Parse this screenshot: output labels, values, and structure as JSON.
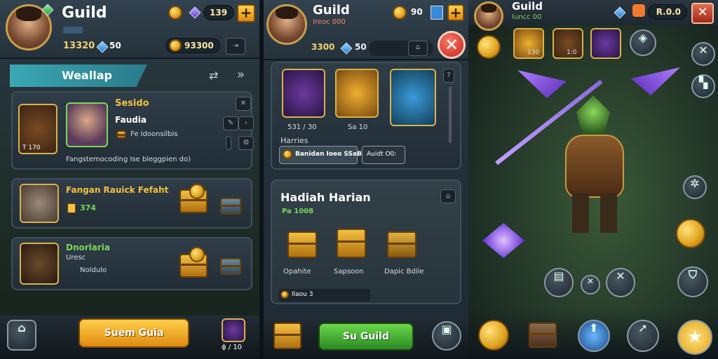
{
  "panel1": {
    "header": {
      "title": "Guild",
      "stat_left": "13320",
      "stat_gems": "50",
      "stat_coins": "93300",
      "gems_top": "139"
    },
    "banner": {
      "label": "Weallap"
    },
    "card1": {
      "title": "Sesido",
      "name": "Faudia",
      "info": "Fe Idoonsilbis",
      "desc": "Fangstemocoding Ise bleggpien do)",
      "levels": "T 170"
    },
    "row1": {
      "title": "Fangan Rauick Fefaht",
      "value": "374"
    },
    "row2": {
      "title": "Dnorlaria",
      "sub": "Uresc",
      "value": "Noldulo"
    },
    "main_button": "Suem Guia",
    "bottom_left": "",
    "bottom_right": "ϕ / 10"
  },
  "panel2": {
    "header": {
      "title": "Guild",
      "subtitle": "Ireoc 000",
      "value_top": "90",
      "stat_left": "3300",
      "stat_gems": "50"
    },
    "items": [
      {
        "label": "531 / 30"
      },
      {
        "label": "Sa 10"
      },
      {
        "label": ""
      }
    ],
    "section_label": "Harries",
    "btn_primary": "Banidan Ioeo SSaB",
    "btn_secondary": "Auidt O0:",
    "daily": {
      "title": "Hadiah Harian",
      "sub": "Pa 1008",
      "rewards": [
        {
          "label": "Opahite"
        },
        {
          "label": "Sapsoon"
        },
        {
          "label": "Dapic Bdile"
        }
      ],
      "progress_label": "Ilaou 3"
    },
    "main_button": "Su Guild"
  },
  "panel3": {
    "header": {
      "title": "Guild",
      "subtitle": "Iuncc 00",
      "value": "R.0.0"
    },
    "items": [
      {
        "label": "130"
      },
      {
        "label": "1:0"
      },
      {
        "label": ""
      },
      {
        "label": ""
      }
    ]
  },
  "colors": {
    "accent_gold": "#f4c040",
    "accent_green": "#54b83a",
    "close_red": "#c02418",
    "gem_blue": "#2d7bd8"
  }
}
